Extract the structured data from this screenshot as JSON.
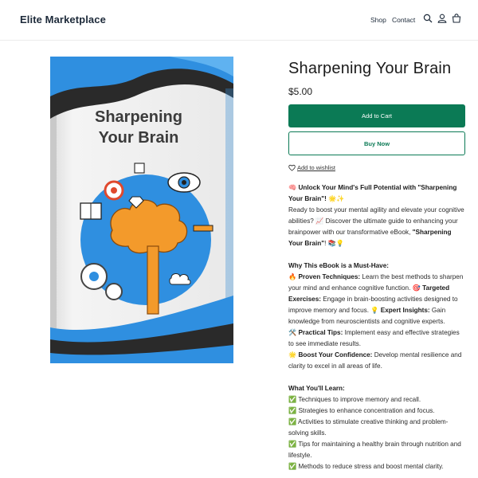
{
  "header": {
    "brand": "Elite Marketplace",
    "nav": [
      "Shop",
      "Contact"
    ],
    "icons": [
      "search-icon",
      "account-icon",
      "cart-icon"
    ]
  },
  "book": {
    "title_line1": "Sharpening",
    "title_line2": "Your Brain"
  },
  "product": {
    "title": "Sharpening Your Brain",
    "price": "$5.00",
    "add_to_cart": "Add to Cart",
    "buy_now": "Buy Now",
    "wishlist": "Add to wishlist"
  },
  "description": {
    "intro_bold": "🧠 Unlock Your Mind's Full Potential with \"Sharpening Your Brain\"! 🌟✨",
    "intro_text_1": "Ready to boost your mental agility and elevate your cognitive abilities? 📈 Discover the ultimate guide to enhancing your brainpower with our transformative eBook, ",
    "intro_book_bold": "\"Sharpening Your Brain\"",
    "intro_text_2": "! 📚💡",
    "why_heading": "Why This eBook is a Must-Have:",
    "why_items": [
      {
        "bold": "🔥 Proven Techniques:",
        "text": " Learn the best methods to sharpen your mind and enhance cognitive function. 🎯"
      },
      {
        "bold": "Targeted Exercises:",
        "text": " Engage in brain-boosting activities designed to improve memory and focus. 💡"
      },
      {
        "bold": "Expert Insights:",
        "text": " Gain knowledge from neuroscientists and cognitive experts."
      },
      {
        "bold": "🛠️ Practical Tips:",
        "text": " Implement easy and effective strategies to see immediate results."
      },
      {
        "bold": "🌟 Boost Your Confidence:",
        "text": " Develop mental resilience and clarity to excel in all areas of life."
      }
    ],
    "learn_heading": "What You'll Learn:",
    "learn_items": [
      "✅ Techniques to improve memory and recall.",
      "✅ Strategies to enhance concentration and focus.",
      "✅ Activities to stimulate creative thinking and problem-solving skills.",
      "✅ Tips for maintaining a healthy brain through nutrition and lifestyle.",
      "✅ Methods to reduce stress and boost mental clarity."
    ]
  },
  "colors": {
    "accent": "#0b7a55",
    "brand_text": "#1d2a3a",
    "book_blue": "#2f8fe0",
    "brain_orange": "#f39a2b"
  }
}
